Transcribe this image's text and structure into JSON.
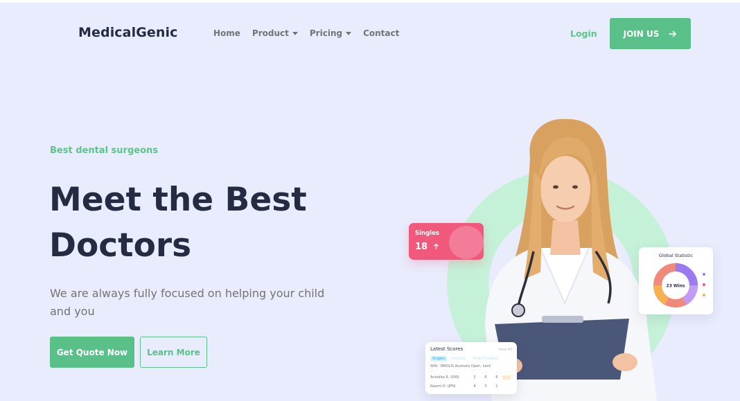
{
  "nav": {
    "logo": "MedicalGenic",
    "items": [
      {
        "label": "Home",
        "dropdown": false
      },
      {
        "label": "Product",
        "dropdown": true
      },
      {
        "label": "Pricing",
        "dropdown": true
      },
      {
        "label": "Contact",
        "dropdown": false
      }
    ],
    "login": "Login",
    "join": "JOIN US",
    "join_icon": "arrow-right-icon"
  },
  "hero": {
    "eyebrow": "Best dental surgeons",
    "headline_line1": "Meet the Best",
    "headline_line2": "Doctors",
    "subtext": "We are always fully focused on helping your child and you",
    "primary_button": "Get Quote Now",
    "secondary_button": "Learn More"
  },
  "cards": {
    "singles": {
      "label": "Singles",
      "value": "18",
      "icon": "arrow-up-icon"
    },
    "global_statistic": {
      "title": "Global Statistic",
      "center": "23 Wins"
    },
    "latest_scores": {
      "title": "Latest Scores",
      "view_all": "View All",
      "tabs": [
        "Singles",
        "Doubles",
        "Mixed Doubles"
      ],
      "note": "WIN · MROLIS Australis Open, hard",
      "rows": [
        {
          "name": "Anindita R. (IDN)",
          "s1": "3",
          "s2": "6",
          "s3": "6"
        },
        {
          "name": "Naomi O. (JPN)",
          "s1": "4",
          "s2": "3",
          "s3": "1"
        }
      ]
    }
  },
  "colors": {
    "accent": "#5ac08a",
    "heading": "#252b42",
    "muted": "#737373",
    "background": "#e9ecfd",
    "pink": "#f0597b",
    "ring": "#c5f1d8"
  }
}
